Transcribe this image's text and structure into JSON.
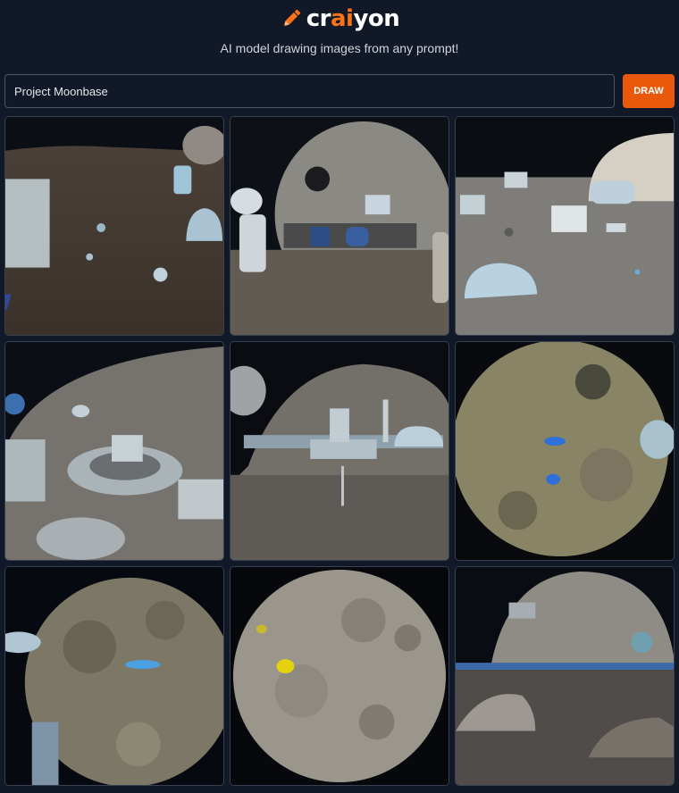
{
  "header": {
    "logo_prefix": "cr",
    "logo_accent": "ai",
    "logo_suffix": "yon",
    "logo_icon": "pencil-icon",
    "tagline": "AI model drawing images from any prompt!"
  },
  "prompt": {
    "value": "Project Moonbase"
  },
  "draw_button": {
    "label": "DRAW"
  },
  "colors": {
    "background": "#111827",
    "accent": "#ea580c",
    "border": "#374151"
  },
  "results": [
    {
      "scene": "moon-surface-base-with-domes"
    },
    {
      "scene": "astronauts-near-domed-moon-structure"
    },
    {
      "scene": "lunar-plain-with-modules-and-dome"
    },
    {
      "scene": "circular-base-complex-under-moon"
    },
    {
      "scene": "station-platform-on-lunar-surface"
    },
    {
      "scene": "moon-with-blue-markers"
    },
    {
      "scene": "full-moon-with-satellite"
    },
    {
      "scene": "full-moon-with-yellow-marker"
    },
    {
      "scene": "moon-over-horizon-landscape"
    }
  ]
}
